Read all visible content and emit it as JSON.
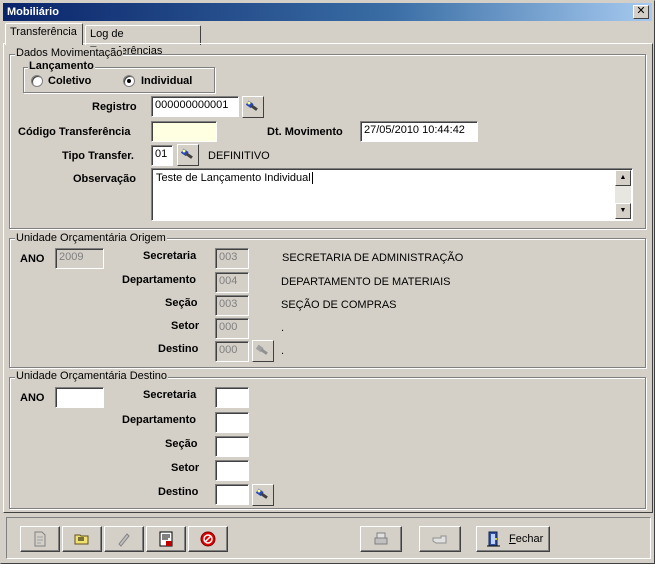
{
  "window": {
    "title": "Mobiliário",
    "close_glyph": "✕"
  },
  "tabs": [
    {
      "label": "Transferência",
      "active": true
    },
    {
      "label": "Log de Transferências",
      "active": false
    }
  ],
  "dados": {
    "legend": "Dados Movimentação",
    "lancamento": {
      "legend": "Lançamento",
      "options": [
        {
          "label": "Coletivo",
          "checked": false
        },
        {
          "label": "Individual",
          "checked": true
        }
      ]
    },
    "registro": {
      "label": "Registro",
      "value": "000000000001"
    },
    "codigo": {
      "label": "Código Transferência",
      "value": ""
    },
    "dt_movimento": {
      "label": "Dt. Movimento",
      "value": "27/05/2010 10:44:42"
    },
    "tipo": {
      "label": "Tipo Transfer.",
      "value": "01",
      "description": "DEFINITIVO"
    },
    "observacao": {
      "label": "Observação",
      "value": "Teste de Lançamento Individual"
    }
  },
  "origem": {
    "legend": "Unidade Orçamentária Origem",
    "ano": {
      "label": "ANO",
      "value": "2009"
    },
    "rows": [
      {
        "label": "Secretaria",
        "code": "003",
        "description": "SECRETARIA DE ADMINISTRAÇÃO"
      },
      {
        "label": "Departamento",
        "code": "004",
        "description": "DEPARTAMENTO DE MATERIAIS"
      },
      {
        "label": "Seção",
        "code": "003",
        "description": "SEÇÃO DE COMPRAS"
      },
      {
        "label": "Setor",
        "code": "000",
        "description": "."
      },
      {
        "label": "Destino",
        "code": "000",
        "description": "."
      }
    ]
  },
  "destino": {
    "legend": "Unidade Orçamentária Destino",
    "ano": {
      "label": "ANO",
      "value": ""
    },
    "rows": [
      {
        "label": "Secretaria",
        "code": ""
      },
      {
        "label": "Departamento",
        "code": ""
      },
      {
        "label": "Seção",
        "code": ""
      },
      {
        "label": "Setor",
        "code": ""
      },
      {
        "label": "Destino",
        "code": ""
      }
    ]
  },
  "toolbar": {
    "buttons": [
      {
        "name": "new-record",
        "icon": "new-document-icon",
        "enabled": false
      },
      {
        "name": "open",
        "icon": "open-folder-icon",
        "enabled": true
      },
      {
        "name": "edit",
        "icon": "edit-pencil-icon",
        "enabled": false
      },
      {
        "name": "save",
        "icon": "save-disk-icon",
        "enabled": true
      },
      {
        "name": "cancel",
        "icon": "cancel-circle-icon",
        "enabled": true
      },
      {
        "name": "print",
        "icon": "printer-icon",
        "enabled": false
      },
      {
        "name": "confirm",
        "icon": "pointing-hand-icon",
        "enabled": false
      }
    ],
    "close_prefix": "F",
    "close_rest": "echar"
  },
  "colors": {
    "title_gradient_start": "#0a246a",
    "title_gradient_end": "#a6caf0",
    "face": "#d4d0c8",
    "required_field": "#ffffe1"
  }
}
